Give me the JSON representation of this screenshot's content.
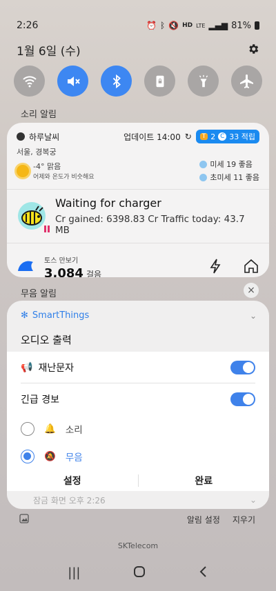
{
  "status": {
    "time": "2:26",
    "hd": "HD",
    "lte": "LTE",
    "battery": "81%"
  },
  "header": {
    "date": "1월 6일 (수)"
  },
  "quick_toggles": [
    {
      "name": "wifi",
      "on": false
    },
    {
      "name": "mute",
      "on": true
    },
    {
      "name": "bluetooth",
      "on": true
    },
    {
      "name": "portrait-lock",
      "on": false
    },
    {
      "name": "flashlight",
      "on": false
    },
    {
      "name": "airplane",
      "on": false
    }
  ],
  "sections": {
    "sound_alerts": "소리 알림",
    "silent_alerts": "무음 알림"
  },
  "weather": {
    "app": "하루날씨",
    "updated": "업데이트 14:00",
    "points_t": "2",
    "points_c": "33 적립",
    "location": "서울, 경복궁",
    "temp": "-4° 맑음",
    "compare": "어제와 온도가 비슷해요",
    "dust": "미세 19 좋음",
    "fine_dust": "초미세 11 좋음"
  },
  "charger": {
    "title": "Waiting for charger",
    "detail": "Cr gained: 6398.83 Cr  Traffic today: 43.7 MB"
  },
  "toss": {
    "label": "토스 만보기",
    "steps": "3,084",
    "unit": "걸음"
  },
  "smartthings": {
    "app": "SmartThings",
    "title": "오디오 출력",
    "row1": "재난문자",
    "row2": "긴급 경보",
    "opt1": "소리",
    "opt2": "무음",
    "btn_settings": "설정",
    "btn_done": "완료",
    "peek_text": "잠금 화면 오후 2:26"
  },
  "bottom": {
    "notif_settings": "알림 설정",
    "clear": "지우기"
  },
  "carrier": "SKTelecom"
}
